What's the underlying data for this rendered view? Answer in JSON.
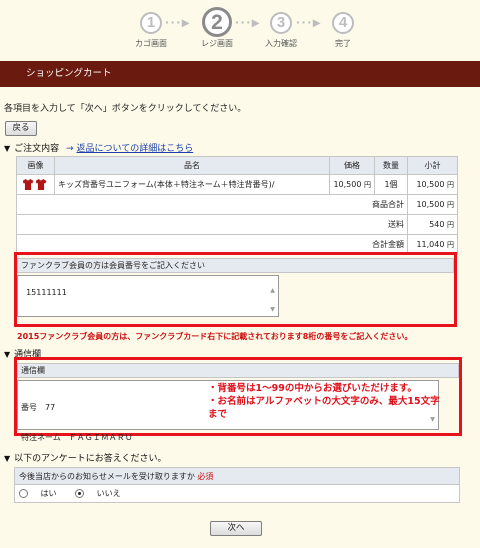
{
  "steps": [
    {
      "num": "①",
      "label": "カゴ画面"
    },
    {
      "num": "②",
      "label": "レジ画面"
    },
    {
      "num": "③",
      "label": "入力確認"
    },
    {
      "num": "④",
      "label": "完了"
    }
  ],
  "step_digits": [
    "1",
    "2",
    "3",
    "4"
  ],
  "header_title": "ショッピングカート",
  "instruction": "各項目を入力して「次へ」ボタンをクリックしてください。",
  "back_button": "戻る",
  "order_section": {
    "title": "ご注文内容",
    "arrow": "→",
    "return_link": "返品についての詳細はこちら"
  },
  "cart": {
    "headers": [
      "画像",
      "品名",
      "価格",
      "数量",
      "小計"
    ],
    "item": {
      "name": "キッズ背番号ユニフォーム(本体＋特注ネーム＋特注背番号)/",
      "price": "10,500",
      "price_unit": "円",
      "qty": "1個",
      "subtotal": "10,500",
      "subtotal_unit": "円"
    },
    "summary": [
      {
        "label": "商品合計",
        "value": "10,500",
        "unit": "円"
      },
      {
        "label": "送料",
        "value": "540",
        "unit": "円"
      },
      {
        "label": "合計金額",
        "value": "11,040",
        "unit": "円"
      }
    ]
  },
  "fanclub": {
    "label": "ファンクラブ会員の方は会員番号をご記入ください",
    "value": "15111111",
    "notice": "2015ファンクラブ会員の方は、ファンクラブカード右下に記載されております8桁の番号をご記入ください。"
  },
  "comm": {
    "section_title": "通信欄",
    "label": "通信欄",
    "line1": "番号　77",
    "line2": "特注ネーム　ＦＡＧＩＭＡＲＵ",
    "note1": "・背番号は1～99の中からお選びいただけます。",
    "note2": "・お名前はアルファベットの大文字のみ、最大15文字",
    "note3": "まで"
  },
  "survey": {
    "section_title": "以下のアンケートにお答えください。",
    "question": "今後当店からのお知らせメールを受け取りますか",
    "required": "必須",
    "options": [
      "はい",
      "いいえ"
    ],
    "selected": "いいえ"
  },
  "next_button": "次へ",
  "colors": {
    "header_bar": "#6b1a10",
    "highlight_border": "#e8121c",
    "notice_text": "#cc1010",
    "table_header": "#e5eaf0",
    "page_bg": "#fdfaea"
  }
}
